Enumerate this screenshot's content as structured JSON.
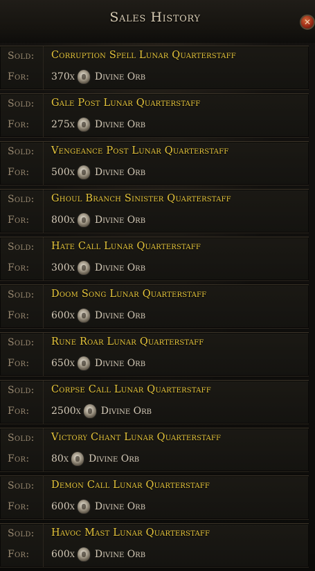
{
  "window": {
    "title": "Sales History"
  },
  "labels": {
    "sold": "Sold:",
    "for": "For:"
  },
  "close_icon_glyph": "✕",
  "entries": [
    {
      "item": "Corruption Spell Lunar Quarterstaff",
      "qty": "370x",
      "currency": "Divine Orb"
    },
    {
      "item": "Gale Post Lunar Quarterstaff",
      "qty": "275x",
      "currency": "Divine Orb"
    },
    {
      "item": "Vengeance Post Lunar Quarterstaff",
      "qty": "500x",
      "currency": "Divine Orb"
    },
    {
      "item": "Ghoul Branch Sinister Quarterstaff",
      "qty": "800x",
      "currency": "Divine Orb"
    },
    {
      "item": "Hate Call Lunar Quarterstaff",
      "qty": "300x",
      "currency": "Divine Orb"
    },
    {
      "item": "Doom Song Lunar Quarterstaff",
      "qty": "600x",
      "currency": "Divine Orb"
    },
    {
      "item": "Rune Roar Lunar Quarterstaff",
      "qty": "650x",
      "currency": "Divine Orb"
    },
    {
      "item": "Corpse Call Lunar Quarterstaff",
      "qty": "2500x",
      "currency": "Divine Orb"
    },
    {
      "item": "Victory Chant Lunar Quarterstaff",
      "qty": "80x",
      "currency": "Divine Orb"
    },
    {
      "item": "Demon Call Lunar Quarterstaff",
      "qty": "600x",
      "currency": "Divine Orb"
    },
    {
      "item": "Havoc Mast Lunar Quarterstaff",
      "qty": "600x",
      "currency": "Divine Orb"
    }
  ],
  "colors": {
    "item_name": "#e8c73c",
    "label": "#9a8a72",
    "text": "#d4cab8",
    "background": "#0b0a08"
  },
  "icons": {
    "currency_icon": "divine-orb-icon",
    "close": "close-icon"
  }
}
